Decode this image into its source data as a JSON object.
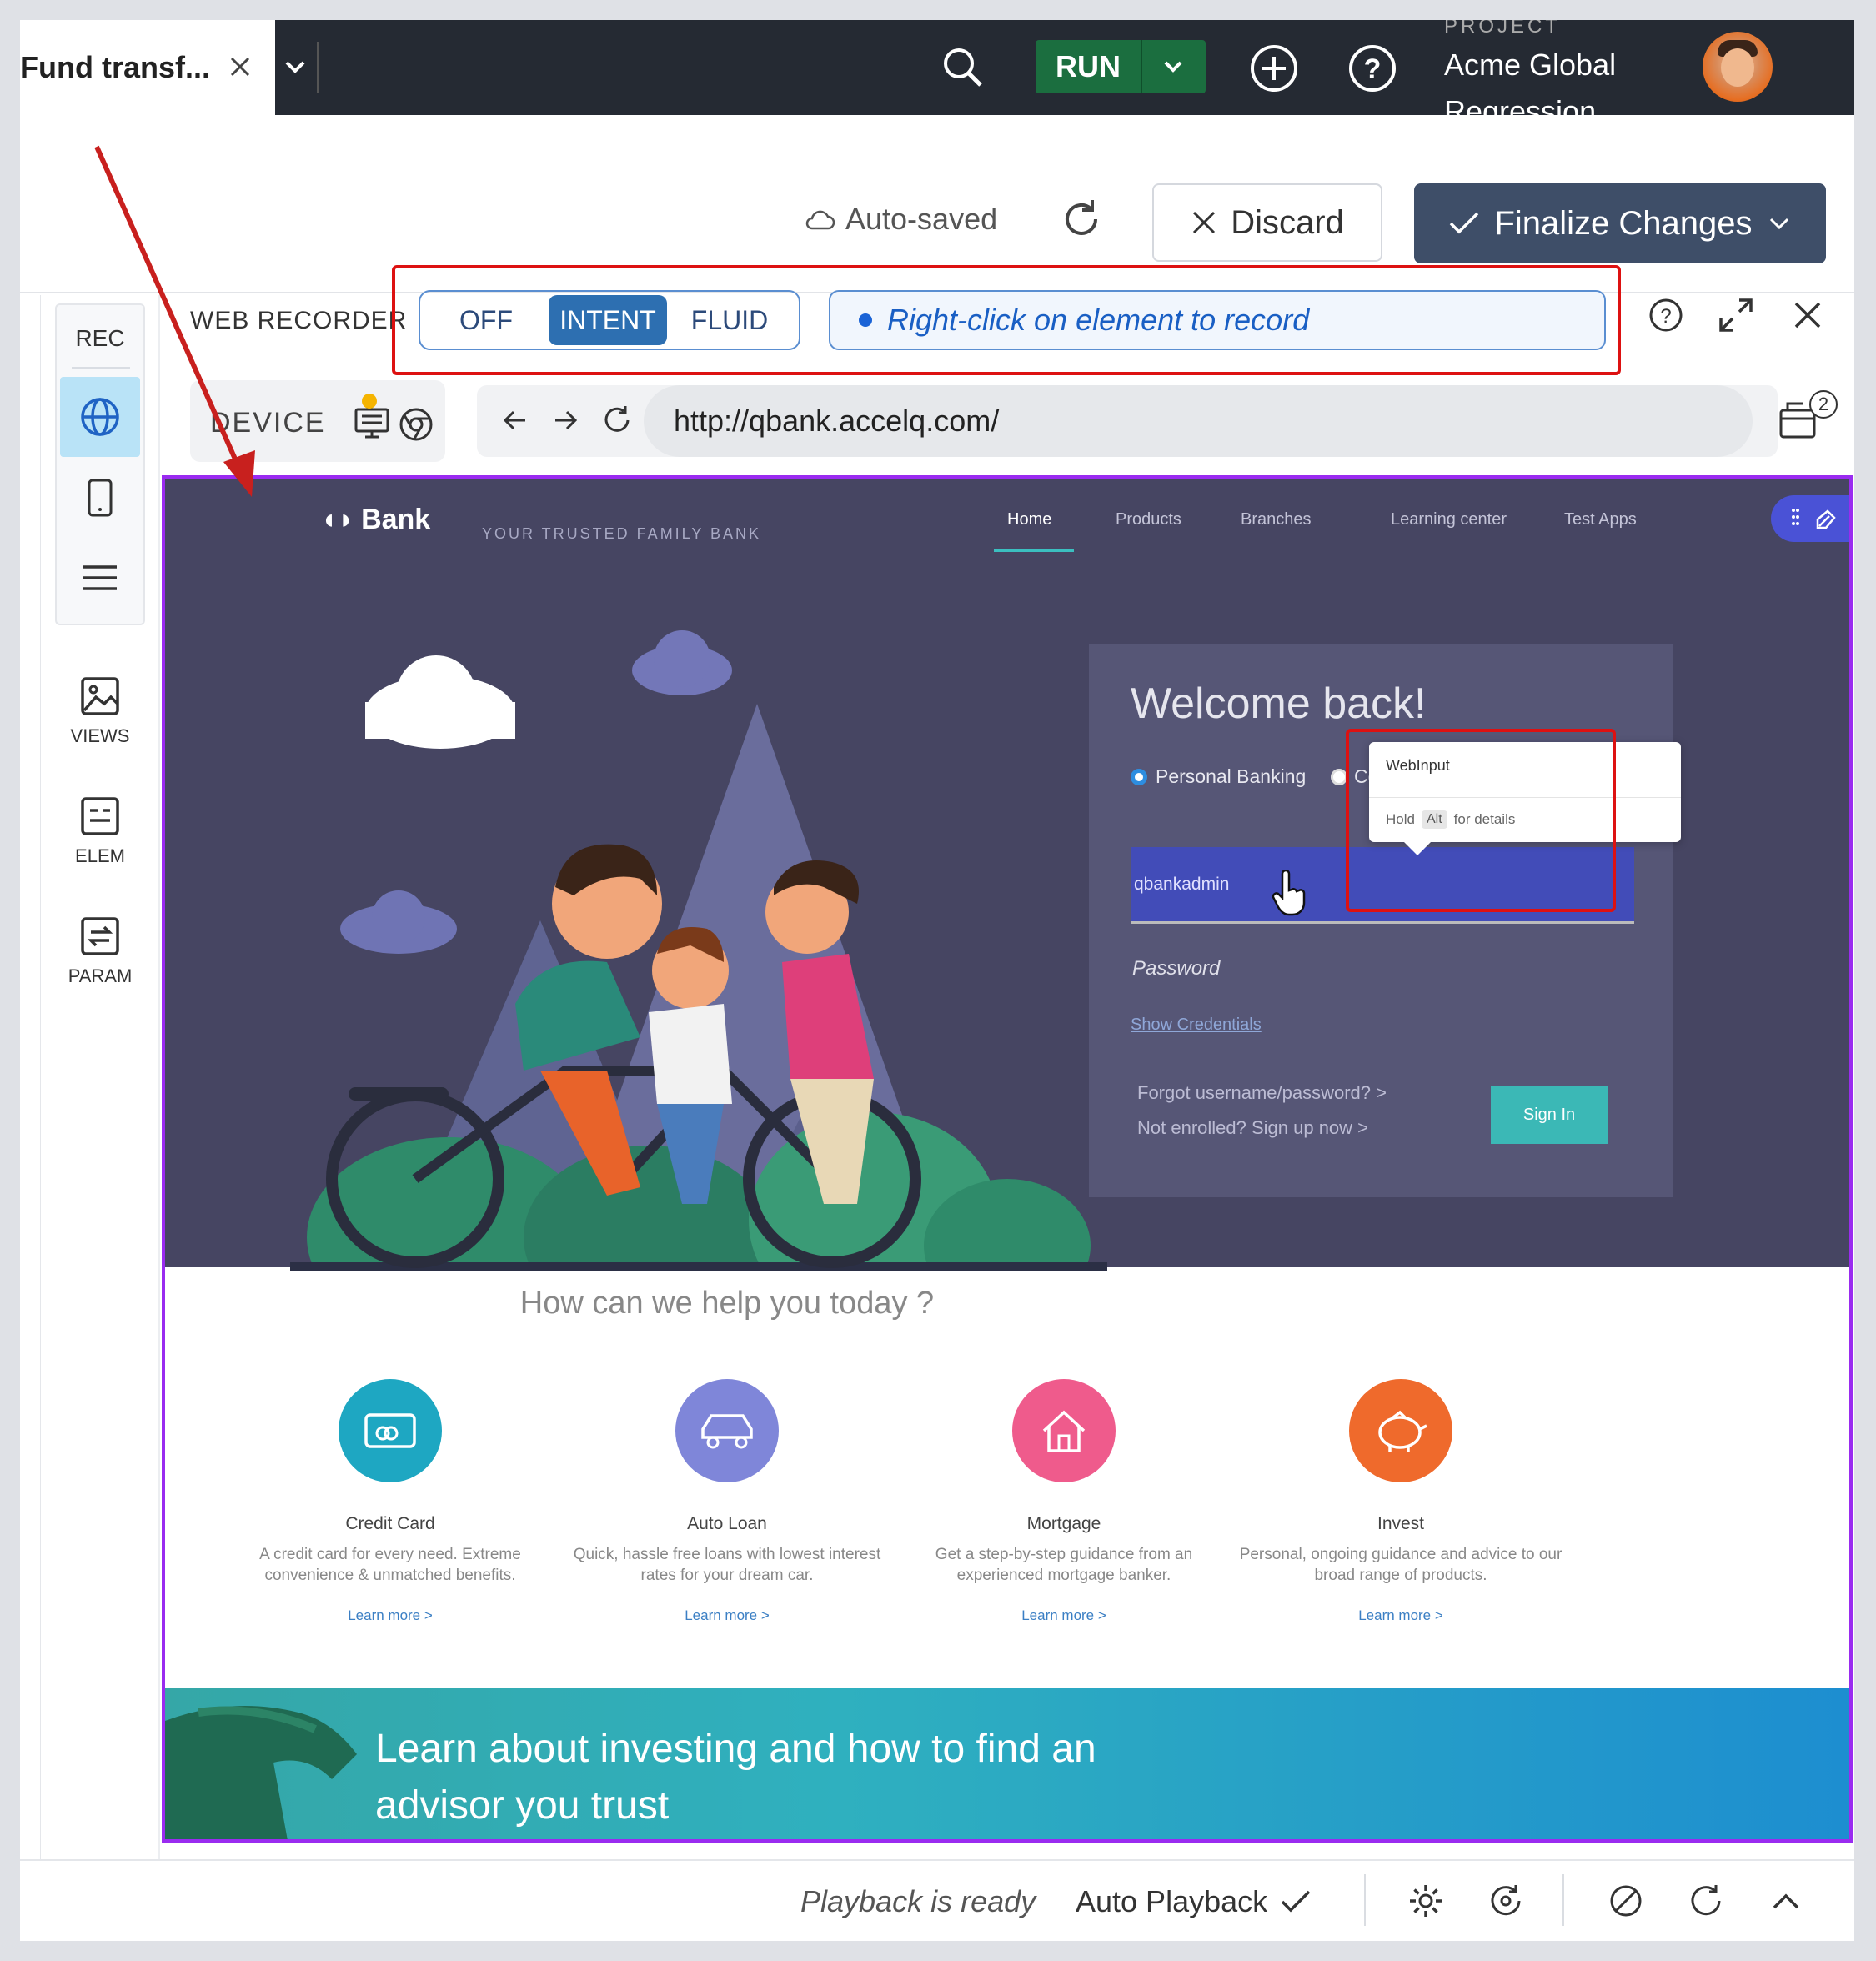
{
  "tab": {
    "title": "Fund transf..."
  },
  "topbar": {
    "run_label": "RUN",
    "project_label": "PROJECT",
    "project_name": "Acme Global Regression"
  },
  "savebar": {
    "autosave": "Auto-saved",
    "discard": "Discard",
    "finalize": "Finalize Changes"
  },
  "sidenav": {
    "rec": "REC",
    "views": "VIEWS",
    "elem": "ELEM",
    "param": "PARAM"
  },
  "recorder": {
    "title": "WEB RECORDER",
    "modes": [
      "OFF",
      "INTENT",
      "FLUID"
    ],
    "active_mode": "INTENT",
    "hint": "Right-click on element to record",
    "device_label": "DEVICE",
    "url": "http://qbank.accelq.com/",
    "tabs_count": "2"
  },
  "site": {
    "logo": "Bank",
    "tagline": "YOUR TRUSTED FAMILY BANK",
    "nav": [
      "Home",
      "Products",
      "Branches",
      "Learning center",
      "Test Apps"
    ],
    "welcome": "Welcome back!",
    "radio_personal": "Personal Banking",
    "radio_corp": "Co",
    "username_value": "qbankadmin",
    "password_placeholder": "Password",
    "show_credentials": "Show Credentials",
    "forgot": "Forgot username/password?  >",
    "enroll": "Not enrolled? Sign up now  >",
    "signin": "Sign In",
    "help_heading": "How can we help you today ?",
    "services": [
      {
        "title": "Credit Card",
        "desc": "A credit card for every need. Extreme convenience & unmatched benefits.",
        "link": "Learn more  >",
        "color": "#1ea7c2"
      },
      {
        "title": "Auto Loan",
        "desc": "Quick, hassle free loans with lowest interest rates for your dream car.",
        "link": "Learn more  >",
        "color": "#7f86d9"
      },
      {
        "title": "Mortgage",
        "desc": "Get a step-by-step guidance from an experienced mortgage banker.",
        "link": "Learn more  >",
        "color": "#ef5b8c"
      },
      {
        "title": "Invest",
        "desc": "Personal, ongoing guidance and advice to our broad range of products.",
        "link": "Learn more  >",
        "color": "#ef6a2c"
      }
    ],
    "banner": "Learn about investing and how to find an advisor you trust"
  },
  "tooltip": {
    "title": "WebInput",
    "hold": "Hold",
    "key": "Alt",
    "details": "for details"
  },
  "statusbar": {
    "ready": "Playback is ready",
    "auto_playback": "Auto Playback"
  }
}
